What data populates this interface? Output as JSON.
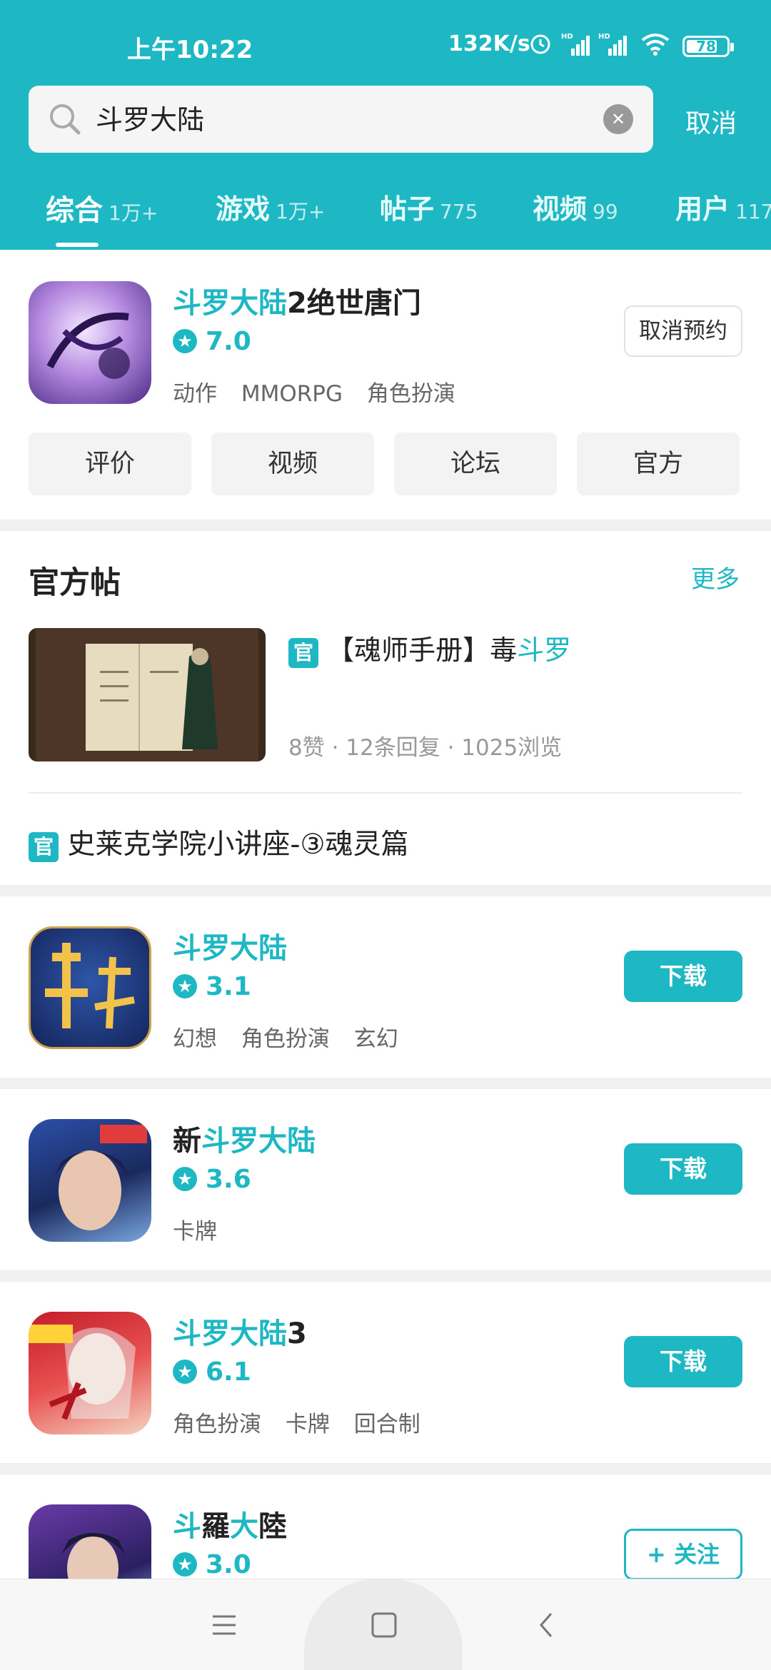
{
  "status_bar": {
    "time": "上午10:22",
    "net_speed": "132K/s",
    "battery": "78",
    "battery_fraction": 0.78
  },
  "search": {
    "query": "斗罗大陆",
    "clear_icon": "clear-icon",
    "cancel_label": "取消"
  },
  "tabs": [
    {
      "label": "综合",
      "count": "1万+",
      "active": true
    },
    {
      "label": "游戏",
      "count": "1万+"
    },
    {
      "label": "帖子",
      "count": "775"
    },
    {
      "label": "视频",
      "count": "99"
    },
    {
      "label": "用户",
      "count": "117"
    }
  ],
  "featured": {
    "title_highlight": "斗罗大陆",
    "title_rest": "2绝世唐门",
    "rating": "7.0",
    "tags": [
      "动作",
      "MMORPG",
      "角色扮演"
    ],
    "action": "取消预约",
    "quick_links": [
      "评价",
      "视频",
      "论坛",
      "官方"
    ]
  },
  "official_posts": {
    "title": "官方帖",
    "more": "更多",
    "badge": "官",
    "post1": {
      "title_prefix": "【魂师手册】毒",
      "title_highlight": "斗罗",
      "meta": "8赞 · 12条回复 · 1025浏览"
    },
    "post2": {
      "title": "史莱克学院小讲座-③魂灵篇"
    }
  },
  "games": [
    {
      "pre": "",
      "hl": "斗罗大陆",
      "post": "",
      "rating": "3.1",
      "tags": [
        "幻想",
        "角色扮演",
        "玄幻"
      ],
      "action": "下载"
    },
    {
      "pre": "新",
      "hl": "斗罗大陆",
      "post": "",
      "rating": "3.6",
      "tags": [
        "卡牌"
      ],
      "action": "下载"
    },
    {
      "pre": "",
      "hl": "斗罗大陆",
      "post": "3",
      "rating": "6.1",
      "tags": [
        "角色扮演",
        "卡牌",
        "回合制"
      ],
      "action": "下载"
    },
    {
      "hl1": "斗",
      "mid": "羅",
      "hl2": "大",
      "post": "陸",
      "rating": "3.0",
      "action": "+ 关注"
    }
  ],
  "colors": {
    "accent": "#1db8c3",
    "divider": "#f0f0f0"
  }
}
